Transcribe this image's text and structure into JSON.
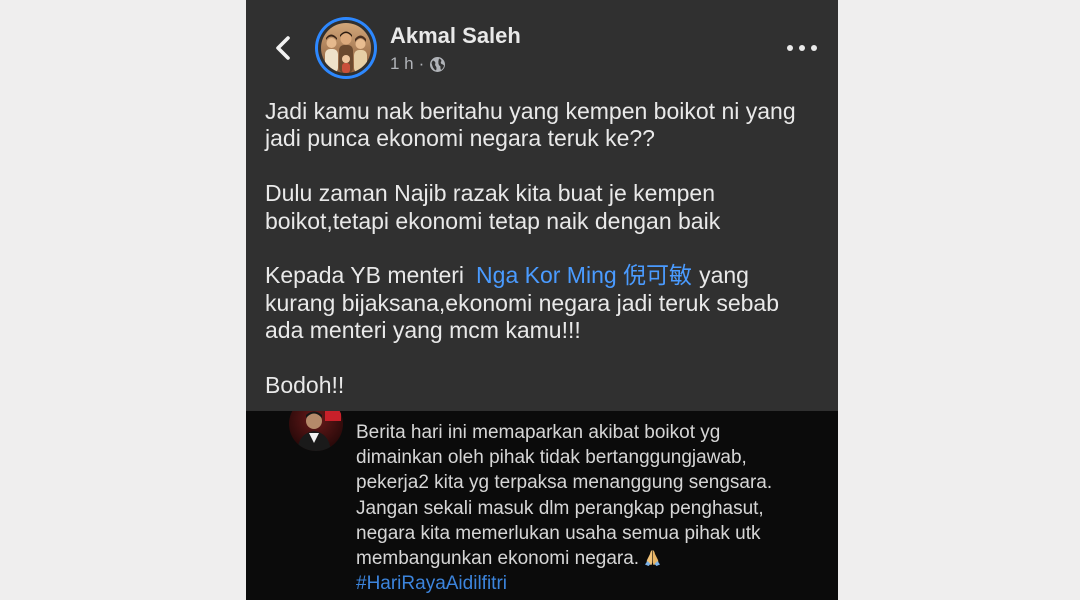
{
  "colors": {
    "page_bg": "#efeeee",
    "panel_bg": "#303030",
    "tweet_bg": "#0b0b0b",
    "text_primary": "#e9e9e9",
    "text_secondary": "#b0b3b8",
    "link": "#4a9bff",
    "hashtag": "#3c84dc",
    "avatar_ring": "#2d88ff"
  },
  "header": {
    "back_icon": "chevron-left-icon",
    "author_name": "Akmal Saleh",
    "timestamp": "1 h",
    "separator": "·",
    "privacy_icon": "globe-icon",
    "more_icon": "more-horizontal-icon"
  },
  "post": {
    "paragraphs": [
      {
        "lines": [
          "Jadi kamu nak beritahu yang kempen boikot ni yang",
          "jadi punca ekonomi negara teruk ke??"
        ]
      },
      {
        "lines": [
          "Dulu zaman Najib razak kita buat je kempen",
          "boikot,tetapi ekonomi tetap naik dengan baik"
        ]
      },
      {
        "first_line": {
          "before": "Kepada YB menteri",
          "mention": "Nga Kor Ming 倪可敏",
          "after": "yang"
        },
        "lines": [
          "kurang bijaksana,ekonomi negara jadi teruk sebab",
          "ada menteri yang mcm kamu!!!"
        ]
      },
      {
        "lines": [
          "Bodoh!!"
        ]
      }
    ]
  },
  "attached_image": {
    "tweet_lines": [
      "Berita hari ini memaparkan akibat boikot yg",
      "dimainkan oleh pihak tidak bertanggungjawab,",
      "pekerja2 kita yg terpaksa menanggung sengsara.",
      "Jangan sekali masuk dlm perangkap penghasut,",
      "negara kita memerlukan usaha semua pihak utk",
      "membangunkan ekonomi negara."
    ],
    "emoji_icon": "folded-hands-icon",
    "hashtag": "#HariRayaAidilfitri"
  }
}
